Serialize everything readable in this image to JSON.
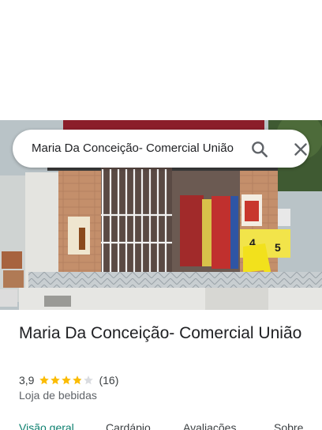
{
  "search": {
    "value": "Maria Da Conceição- Comercial União"
  },
  "place": {
    "title": "Maria Da Conceição- Comercial União",
    "rating": "3,9",
    "rating_stars": 3.9,
    "review_count": "(16)",
    "category": "Loja de bebidas"
  },
  "tabs": [
    {
      "label": "Visão geral",
      "active": true
    },
    {
      "label": "Cardápio",
      "active": false
    },
    {
      "label": "Avaliações",
      "active": false
    },
    {
      "label": "Sobre",
      "active": false
    }
  ],
  "photo": {
    "sign_price_1": "4",
    "sign_price_2": "5"
  },
  "colors": {
    "star": "#fbbc04",
    "star_empty": "#dadce0",
    "active_tab": "#0b7f6e"
  },
  "icons": {
    "search": "search-icon",
    "close": "close-icon"
  }
}
